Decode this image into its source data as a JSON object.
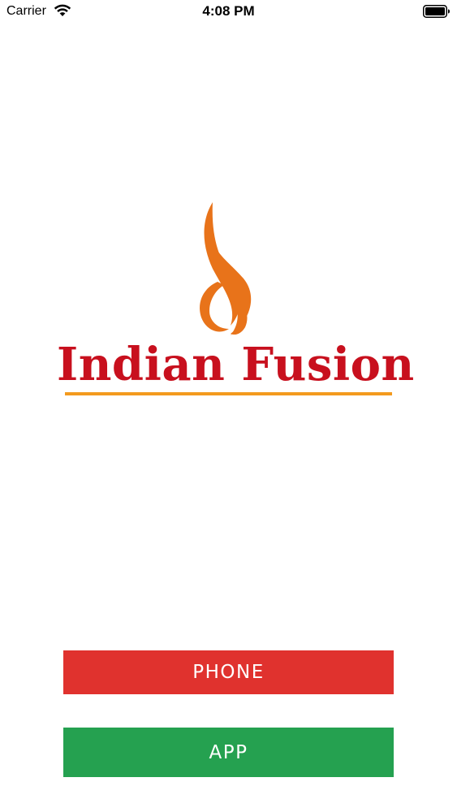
{
  "status_bar": {
    "carrier": "Carrier",
    "time": "4:08 PM"
  },
  "logo": {
    "brand_name": "Indian Fusion",
    "icon": "flame-icon",
    "text_color": "#c8101e",
    "flame_color": "#e8731a",
    "underline_color": "#f39a1e"
  },
  "buttons": {
    "phone_label": "PHONE",
    "app_label": "APP",
    "phone_color": "#e0322e",
    "app_color": "#25a150"
  }
}
